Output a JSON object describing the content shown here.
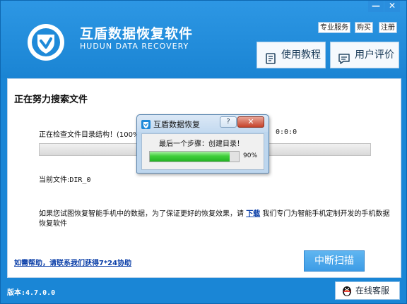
{
  "window": {
    "title": "互盾数据恢复软件",
    "subtitle": "HUDUN DATA RECOVERY",
    "minimize": "—",
    "close": "✕"
  },
  "header": {
    "links": [
      "专业服务",
      "购买",
      "注册"
    ],
    "tutorial_label": "使用教程",
    "review_label": "用户评价"
  },
  "main": {
    "search_title": "正在努力搜索文件",
    "check_text": "正在检查文件目录结构！(100%",
    "elapsed_time": "0:0:0",
    "current_file_label": "当前文件:",
    "current_file_value": "DIR_0",
    "mobile_note_before": "如果您试图恢复智能手机中的数据，为了保证更好的恢复效果，请",
    "download_label": "下载",
    "mobile_note_after": "我们专门为智能手机定制开发的手机数据恢复软件",
    "help_link": "如需帮助，请联系我们获得7*24协助",
    "stop_label": "中断扫描"
  },
  "footer": {
    "version": "版本:4.7.0.0",
    "service_label": "在线客服"
  },
  "dialog": {
    "title": "互盾数据恢复",
    "help_label": "?",
    "close_label": "✕",
    "step_text": "最后一个步骤：创建目录！",
    "progress": 90,
    "progress_text": "90%"
  },
  "colors": {
    "brand_blue": "#1a86d6",
    "progress_green": "#3fcf3a",
    "link_blue": "#0a3ea8"
  },
  "icons": [
    "shield-logo-icon",
    "book-icon",
    "chat-icon",
    "penguin-icon"
  ]
}
